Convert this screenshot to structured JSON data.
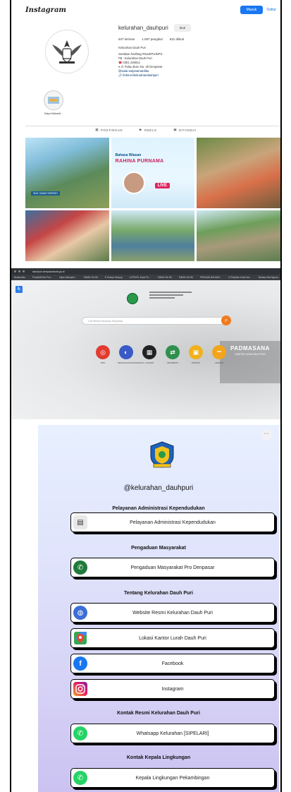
{
  "instagram": {
    "logo": "Instagram",
    "login_label": "Masuk",
    "signup_label": "Daftar",
    "username": "kelurahan_dauhpuri",
    "follow_label": "Ikuti",
    "stats": {
      "posts": "637 kiriman",
      "followers": "1.097 pengikut",
      "following": "631 diikuti"
    },
    "bio": {
      "name": "Kelurahan Dauh Puri",
      "line1": "Sertakan hashtag #DauhPuriDPS",
      "line2": "FB : Kelurahan Dauh Puri",
      "phone": "0361 226812",
      "address": "Jl. Pulau Buru No. 40 Denpasar",
      "handle": "@satar.sarjanamardika",
      "link": "linktr.ee/kelurahandauhpuri"
    },
    "highlight_label": "Satya Mahardi...",
    "tabs": [
      "POSTINGAN",
      "REELS",
      "DITANDAI"
    ],
    "post2": {
      "small": "Bahasa Wiasan",
      "name": "RAHINA PURNAMA",
      "live": "LIVE"
    },
    "post1_caption": "SIAT JUMAT BERSIH"
  },
  "website": {
    "url": "dauhpuri.denpasarkota.go.id",
    "bookmarks": [
      "Bookmarks",
      "Produktif Kita Puri...",
      "https://dauhpuri...",
      "SIMAK DA INI",
      "E-Kinerja Simpeg",
      "e-PROFIL Dauh Pu...",
      "SIMAK DA INI",
      "SIMAK DA INI",
      "PENGADUAN MAS...",
      "E-Perijinan Kota Den...",
      "Bahasa Kita Ngena..."
    ],
    "search_placeholder": "Cari Berita Kawasan Denpasar",
    "padmasana_title": "PADMASANA",
    "padmasana_sub": "KANTOR LURAH DAUH PURI",
    "icons": [
      {
        "label": "PPID",
        "color": "#e23b2f",
        "glyph": "◎"
      },
      {
        "label": "PENGADUAN MASYARAKAT",
        "color": "#3a5bc7",
        "glyph": "◐"
      },
      {
        "label": "LAYANAN",
        "color": "#222222",
        "glyph": "▦"
      },
      {
        "label": "INFORMASI",
        "color": "#2f8f4e",
        "glyph": "⇄"
      },
      {
        "label": "PRODUK",
        "color": "#f2b01c",
        "glyph": "▣"
      },
      {
        "label": "LAINNYA",
        "color": "#f2a51c",
        "glyph": "•••"
      }
    ]
  },
  "linkinbio": {
    "more_label": "···",
    "handle": "@kelurahan_dauhpuri",
    "sections": [
      {
        "title": "Pelayanan Administrasi Kependudukan",
        "links": [
          {
            "label": "Pelayanan Administrasi Kependudukan",
            "icon": "document-icon",
            "color": "#e8e8e8"
          }
        ]
      },
      {
        "title": "Pengaduan Masyarakat",
        "links": [
          {
            "label": "Pengaduan Masyarakat Pro Denpasar",
            "icon": "complaint-icon",
            "color": "#1f7a3a"
          }
        ]
      },
      {
        "title": "Tentang Kelurahan Dauh Puri",
        "links": [
          {
            "label": "Website Resmi Kelurahan Dauh Puri",
            "icon": "globe-icon",
            "color": "#3b6fd6"
          },
          {
            "label": "Lokasi Kantor Lurah Dauh Puri",
            "icon": "map-pin-icon",
            "color": "#34a853"
          },
          {
            "label": "Facebook",
            "icon": "facebook-icon",
            "color": "#1877f2"
          },
          {
            "label": "Instagram",
            "icon": "instagram-icon",
            "color": "#d6249f"
          }
        ]
      },
      {
        "title": "Kontak Resmi Kelurahan Dauh Puri",
        "links": [
          {
            "label": "Whatsapp Kelurahan [SIPELARI]",
            "icon": "whatsapp-icon",
            "color": "#25d366"
          }
        ]
      },
      {
        "title": "Kontak Kepala Lingkungan",
        "links": [
          {
            "label": "Kepala Lingkungan Pekambingan",
            "icon": "whatsapp-icon",
            "color": "#25d366"
          }
        ]
      }
    ]
  }
}
